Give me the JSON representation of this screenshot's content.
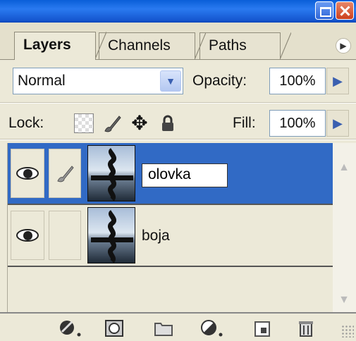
{
  "window": {
    "minimize_icon": "minimize-icon",
    "close_icon": "close-icon"
  },
  "tabs": [
    {
      "label": "Layers",
      "active": true
    },
    {
      "label": "Channels",
      "active": false
    },
    {
      "label": "Paths",
      "active": false
    }
  ],
  "blend": {
    "mode": "Normal",
    "opacity_label": "Opacity:",
    "opacity_value": "100%"
  },
  "lock": {
    "label": "Lock:",
    "fill_label": "Fill:",
    "fill_value": "100%"
  },
  "layers": [
    {
      "name": "olovka",
      "selected": true,
      "visible": true,
      "editing": true
    },
    {
      "name": "boja",
      "selected": false,
      "visible": true,
      "editing": false
    }
  ],
  "colors": {
    "selection": "#316ac5",
    "panel": "#ece9d8",
    "titlebar": "#1556cf"
  }
}
